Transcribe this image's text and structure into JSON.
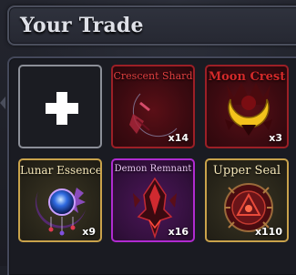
{
  "header": {
    "title": "Your Trade"
  },
  "slots": [
    {
      "type": "empty",
      "icon": "plus-icon"
    },
    {
      "name": "Crescent Shard",
      "quantity": "x14",
      "color": "#e04040",
      "icon": "crescent-shard-icon"
    },
    {
      "name": "Moon Crest",
      "quantity": "x3",
      "color": "#d42a2a",
      "icon": "moon-crest-icon"
    },
    {
      "name": "Lunar Essence",
      "quantity": "x9",
      "color": "#f4e6b8",
      "icon": "lunar-essence-icon"
    },
    {
      "name": "Demon Remnant",
      "quantity": "x16",
      "color": "#e9c6f2",
      "icon": "demon-remnant-icon"
    },
    {
      "name": "Upper Seal",
      "quantity": "x110",
      "color": "#f4e6b8",
      "icon": "upper-seal-icon"
    }
  ]
}
